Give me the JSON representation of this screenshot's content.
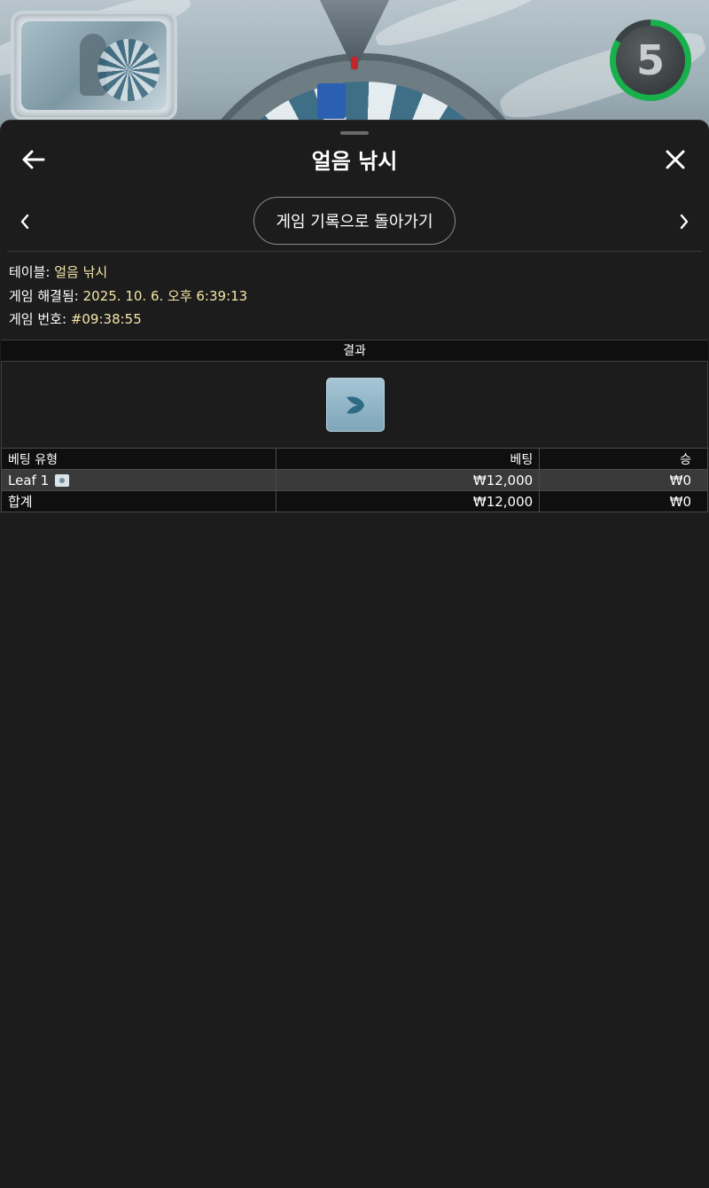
{
  "game_overlay": {
    "timer_value": "5",
    "timer_color": "#18b04a"
  },
  "header": {
    "title": "얼음 낚시",
    "back_icon": "arrow-left-icon",
    "close_icon": "close-icon"
  },
  "nav": {
    "prev_icon": "chevron-left-icon",
    "next_icon": "chevron-right-icon",
    "history_button_label": "게임 기록으로 돌아가기"
  },
  "info": {
    "table_label": "테이블:",
    "table_value": "얼음 낚시",
    "resolved_label": "게임 해결됨:",
    "resolved_value": "2025. 10. 6. 오후 6:39:13",
    "game_no_label": "게임 번호:",
    "game_no_value": "#09:38:55",
    "value_color": "#f3e6a8"
  },
  "result": {
    "header": "결과",
    "tile_icon": "leaf-icon"
  },
  "bets_table": {
    "columns": [
      "베팅 유형",
      "베팅",
      "승"
    ],
    "rows": [
      {
        "type": "Leaf 1",
        "bet": "₩12,000",
        "win": "₩0"
      }
    ],
    "total": {
      "type": "합계",
      "bet": "₩12,000",
      "win": "₩0"
    }
  }
}
